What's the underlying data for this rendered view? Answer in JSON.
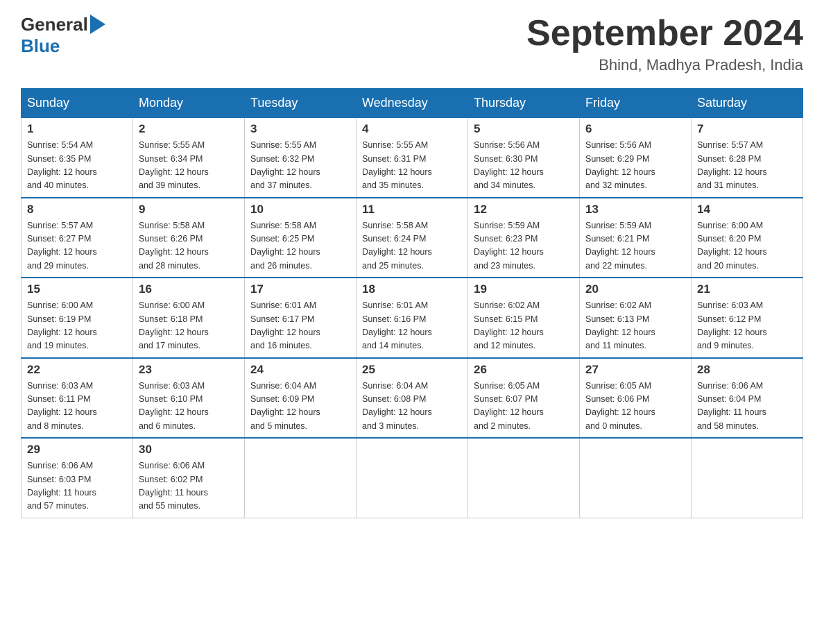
{
  "header": {
    "logo_general": "General",
    "logo_blue": "Blue",
    "month": "September 2024",
    "location": "Bhind, Madhya Pradesh, India"
  },
  "days_of_week": [
    "Sunday",
    "Monday",
    "Tuesday",
    "Wednesday",
    "Thursday",
    "Friday",
    "Saturday"
  ],
  "weeks": [
    [
      {
        "day": "1",
        "sunrise": "5:54 AM",
        "sunset": "6:35 PM",
        "daylight": "12 hours and 40 minutes."
      },
      {
        "day": "2",
        "sunrise": "5:55 AM",
        "sunset": "6:34 PM",
        "daylight": "12 hours and 39 minutes."
      },
      {
        "day": "3",
        "sunrise": "5:55 AM",
        "sunset": "6:32 PM",
        "daylight": "12 hours and 37 minutes."
      },
      {
        "day": "4",
        "sunrise": "5:55 AM",
        "sunset": "6:31 PM",
        "daylight": "12 hours and 35 minutes."
      },
      {
        "day": "5",
        "sunrise": "5:56 AM",
        "sunset": "6:30 PM",
        "daylight": "12 hours and 34 minutes."
      },
      {
        "day": "6",
        "sunrise": "5:56 AM",
        "sunset": "6:29 PM",
        "daylight": "12 hours and 32 minutes."
      },
      {
        "day": "7",
        "sunrise": "5:57 AM",
        "sunset": "6:28 PM",
        "daylight": "12 hours and 31 minutes."
      }
    ],
    [
      {
        "day": "8",
        "sunrise": "5:57 AM",
        "sunset": "6:27 PM",
        "daylight": "12 hours and 29 minutes."
      },
      {
        "day": "9",
        "sunrise": "5:58 AM",
        "sunset": "6:26 PM",
        "daylight": "12 hours and 28 minutes."
      },
      {
        "day": "10",
        "sunrise": "5:58 AM",
        "sunset": "6:25 PM",
        "daylight": "12 hours and 26 minutes."
      },
      {
        "day": "11",
        "sunrise": "5:58 AM",
        "sunset": "6:24 PM",
        "daylight": "12 hours and 25 minutes."
      },
      {
        "day": "12",
        "sunrise": "5:59 AM",
        "sunset": "6:23 PM",
        "daylight": "12 hours and 23 minutes."
      },
      {
        "day": "13",
        "sunrise": "5:59 AM",
        "sunset": "6:21 PM",
        "daylight": "12 hours and 22 minutes."
      },
      {
        "day": "14",
        "sunrise": "6:00 AM",
        "sunset": "6:20 PM",
        "daylight": "12 hours and 20 minutes."
      }
    ],
    [
      {
        "day": "15",
        "sunrise": "6:00 AM",
        "sunset": "6:19 PM",
        "daylight": "12 hours and 19 minutes."
      },
      {
        "day": "16",
        "sunrise": "6:00 AM",
        "sunset": "6:18 PM",
        "daylight": "12 hours and 17 minutes."
      },
      {
        "day": "17",
        "sunrise": "6:01 AM",
        "sunset": "6:17 PM",
        "daylight": "12 hours and 16 minutes."
      },
      {
        "day": "18",
        "sunrise": "6:01 AM",
        "sunset": "6:16 PM",
        "daylight": "12 hours and 14 minutes."
      },
      {
        "day": "19",
        "sunrise": "6:02 AM",
        "sunset": "6:15 PM",
        "daylight": "12 hours and 12 minutes."
      },
      {
        "day": "20",
        "sunrise": "6:02 AM",
        "sunset": "6:13 PM",
        "daylight": "12 hours and 11 minutes."
      },
      {
        "day": "21",
        "sunrise": "6:03 AM",
        "sunset": "6:12 PM",
        "daylight": "12 hours and 9 minutes."
      }
    ],
    [
      {
        "day": "22",
        "sunrise": "6:03 AM",
        "sunset": "6:11 PM",
        "daylight": "12 hours and 8 minutes."
      },
      {
        "day": "23",
        "sunrise": "6:03 AM",
        "sunset": "6:10 PM",
        "daylight": "12 hours and 6 minutes."
      },
      {
        "day": "24",
        "sunrise": "6:04 AM",
        "sunset": "6:09 PM",
        "daylight": "12 hours and 5 minutes."
      },
      {
        "day": "25",
        "sunrise": "6:04 AM",
        "sunset": "6:08 PM",
        "daylight": "12 hours and 3 minutes."
      },
      {
        "day": "26",
        "sunrise": "6:05 AM",
        "sunset": "6:07 PM",
        "daylight": "12 hours and 2 minutes."
      },
      {
        "day": "27",
        "sunrise": "6:05 AM",
        "sunset": "6:06 PM",
        "daylight": "12 hours and 0 minutes."
      },
      {
        "day": "28",
        "sunrise": "6:06 AM",
        "sunset": "6:04 PM",
        "daylight": "11 hours and 58 minutes."
      }
    ],
    [
      {
        "day": "29",
        "sunrise": "6:06 AM",
        "sunset": "6:03 PM",
        "daylight": "11 hours and 57 minutes."
      },
      {
        "day": "30",
        "sunrise": "6:06 AM",
        "sunset": "6:02 PM",
        "daylight": "11 hours and 55 minutes."
      },
      null,
      null,
      null,
      null,
      null
    ]
  ],
  "labels": {
    "sunrise": "Sunrise:",
    "sunset": "Sunset:",
    "daylight": "Daylight:"
  }
}
